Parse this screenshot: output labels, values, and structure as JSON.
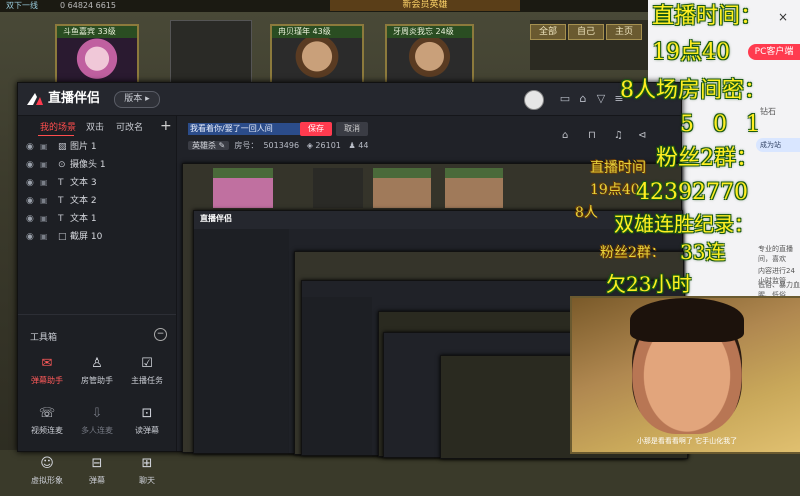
{
  "game": {
    "topbar_left": "双下一线",
    "topbar_info": "0 64824 6615",
    "title": "新会员英雄",
    "tabs": [
      "全部",
      "自己",
      "主页"
    ],
    "players": [
      {
        "name": "斗鱼嘉宾",
        "level": "33级"
      },
      {
        "name": "冉贝瑾年",
        "level": "43级"
      },
      {
        "name": "牙周炎我忘",
        "level": "24级"
      }
    ]
  },
  "app": {
    "logo": "直播伴侣",
    "version": "版本",
    "sidebar": {
      "tabs": [
        "我的场景",
        "双击",
        "可改名"
      ],
      "sources": [
        {
          "icon": "image-icon",
          "label": "图片 1"
        },
        {
          "icon": "camera-icon",
          "label": "摄像头 1"
        },
        {
          "icon": "text-icon",
          "label": "文本 3"
        },
        {
          "icon": "text-icon",
          "label": "文本 2"
        },
        {
          "icon": "text-icon",
          "label": "文本 1"
        },
        {
          "icon": "screenshot-icon",
          "label": "截屏 10"
        }
      ],
      "tools_title": "工具箱",
      "tools": [
        {
          "name": "danmu",
          "label": "弹幕助手",
          "icon": "✉",
          "style": "red"
        },
        {
          "name": "room-manager",
          "label": "房管助手",
          "icon": "♙",
          "style": ""
        },
        {
          "name": "streamer-task",
          "label": "主播任务",
          "icon": "☑",
          "style": ""
        },
        {
          "name": "video-link",
          "label": "视频连麦",
          "icon": "☏",
          "style": ""
        },
        {
          "name": "multi-link",
          "label": "多人连麦",
          "icon": "⇩",
          "style": "dim"
        },
        {
          "name": "read-danmu",
          "label": "读弹幕",
          "icon": "⊡",
          "style": ""
        },
        {
          "name": "tool-7",
          "label": "虚拟形象",
          "icon": "☺",
          "style": ""
        },
        {
          "name": "tool-8",
          "label": "弹幕",
          "icon": "⊟",
          "style": ""
        },
        {
          "name": "tool-9",
          "label": "聊天",
          "icon": "⊞",
          "style": ""
        }
      ]
    },
    "title_input": "我看着你/娶了一回人间",
    "save": "保存",
    "cancel": "取消",
    "category": "英雄杀",
    "room_label": "房号：",
    "room_id": "5013496",
    "heat": "26101",
    "viewers": "44"
  },
  "overlay": {
    "line1": "直播时间：",
    "line2": "19点40",
    "line3": "8人场房间密：",
    "line4": "5 0 1",
    "line5": "粉丝2群：",
    "line6": "42392770",
    "line7": "双雄连胜纪录：",
    "line8": "33连",
    "line9": "欠23小时",
    "ghost1": "直播时间",
    "ghost2": "19点40",
    "ghost3": "粉丝2群：",
    "ghost4": "8人"
  },
  "right_panel": {
    "pc_client": "PC客户端",
    "side_texts": [
      "钻石",
      "成为站"
    ],
    "chat_lines": [
      "专业的直播间，喜欢",
      "内容进行24小时监管",
      "低俗、暴力血腥、低俗"
    ]
  },
  "webcam": {
    "subtitle": "小那是看看看啊了  它手山化我了"
  },
  "colors": {
    "accent_red": "#ff3b4f",
    "overlay_yellow": "#ffee22",
    "overlay_outline": "#1b5a10",
    "app_bg": "#202228"
  }
}
